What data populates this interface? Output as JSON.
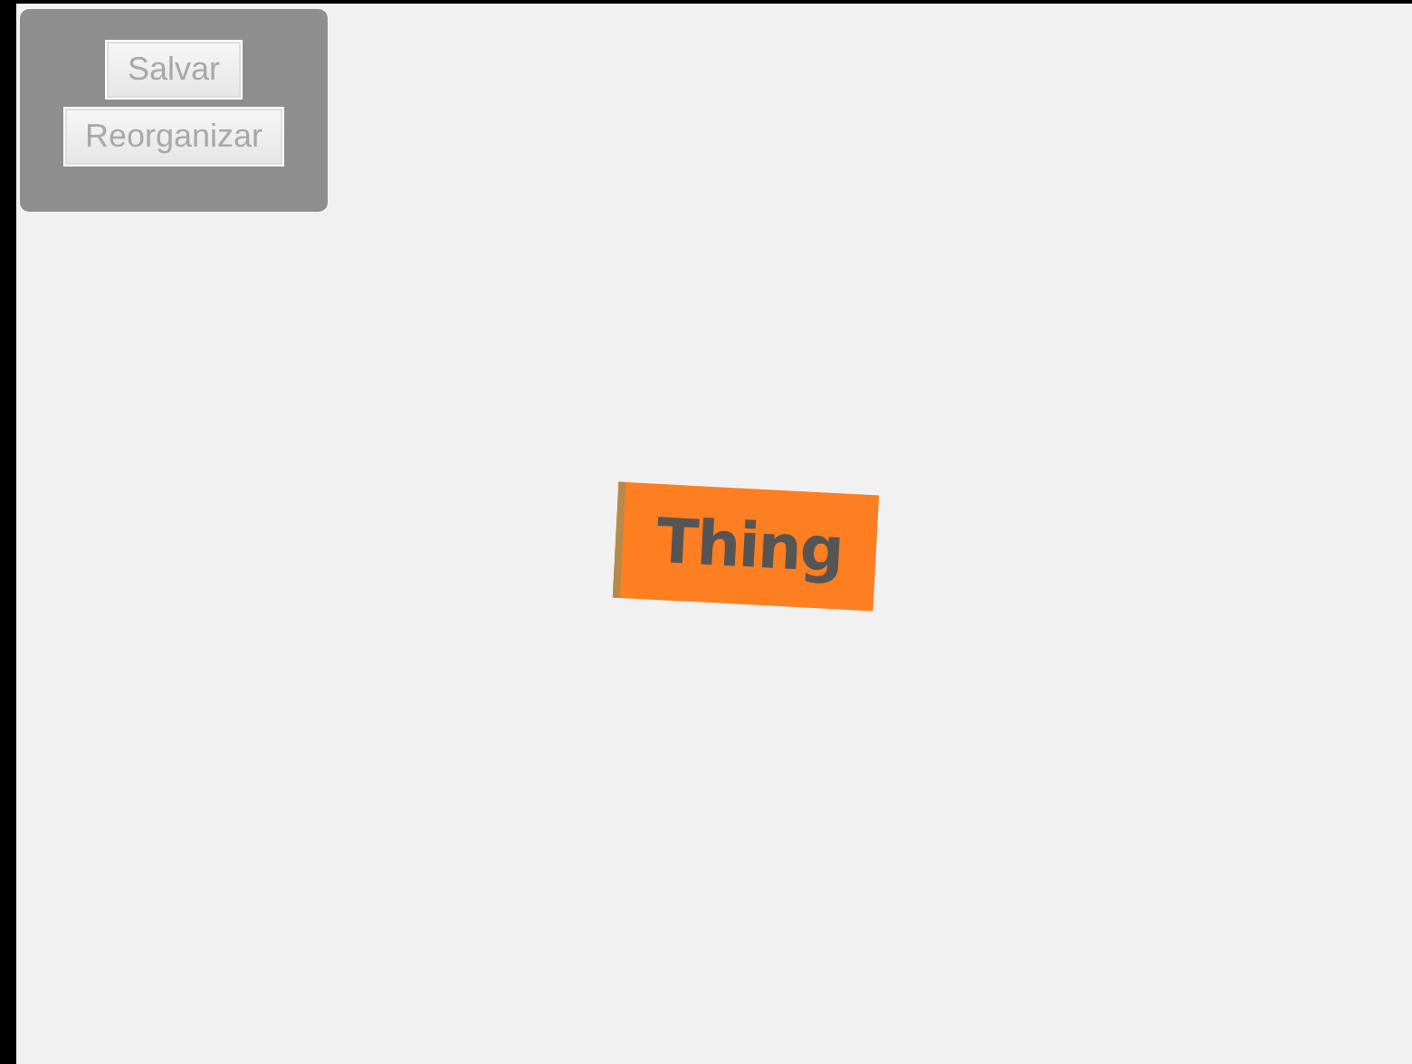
{
  "toolbar": {
    "buttons": [
      "Salvar",
      "Reorganizar"
    ]
  },
  "canvas": {
    "nodes": [
      {
        "label": "Thing"
      }
    ]
  }
}
